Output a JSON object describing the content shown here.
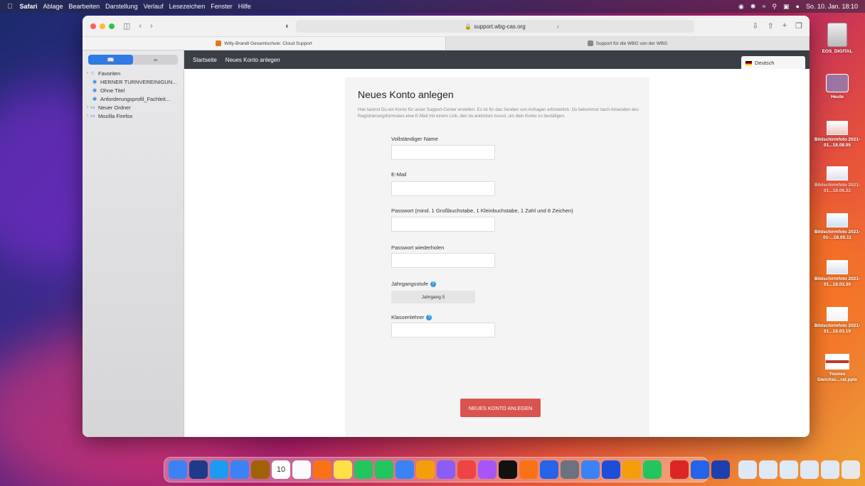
{
  "menubar": {
    "items": [
      "Safari",
      "Ablage",
      "Bearbeiten",
      "Darstellung",
      "Verlauf",
      "Lesezeichen",
      "Fenster",
      "Hilfe"
    ],
    "clock": "So. 10. Jan. 18:10"
  },
  "browser": {
    "address": "support.wbg-cas.org",
    "tabs": [
      {
        "title": "Willy-Brandt Gesamtschule: Cloud Support"
      },
      {
        "title": "Support für die WBG von der WBG"
      }
    ]
  },
  "sidebar": {
    "items": [
      {
        "label": "Favoriten",
        "icon": "star-icon"
      },
      {
        "label": "HERNER TURNVEREINIGUN...",
        "icon": "globe-icon"
      },
      {
        "label": "Ohne Titel",
        "icon": "globe-icon"
      },
      {
        "label": "Anforderungsprofil_Fachleit...",
        "icon": "globe-icon"
      },
      {
        "label": "Neuer Ordner",
        "icon": "folder-icon"
      },
      {
        "label": "Mozilla Firefox",
        "icon": "folder-icon"
      }
    ]
  },
  "site": {
    "nav": [
      "Startseite",
      "Neues Konto anlegen"
    ],
    "language": "Deutsch"
  },
  "form": {
    "title": "Neues Konto anlegen",
    "intro": "Hier kannst Du ein Konto für unser Support-Center erstellen. Es ist für das Senden von Anfragen erforderlich. Du bekommst nach Absenden des Registrierungsformulars eine E-Mail mit einem Link, den du anklicken musst, um dein Konto zu bestätigen.",
    "fields": {
      "name_label": "Vollständiger Name",
      "email_label": "E-Mail",
      "password_label": "Passwort (mind. 1 Großbuchstabe, 1 Kleinbuchstabe, 1 Zahl und 8 Zeichen)",
      "password_repeat_label": "Passwort wiederholen",
      "grade_label": "Jahrgangsstufe",
      "grade_value": "Jahrgang 5",
      "teacher_label": "Klassenlehrer"
    },
    "submit_label": "NEUES KONTO ANLEGEN"
  },
  "desktop": {
    "items": [
      {
        "label": "EOS_DIGITAL"
      },
      {
        "label": "Heute"
      },
      {
        "label": "Bildschirmfoto 2021-01...18.08.05"
      },
      {
        "label": "Bildschirmfoto 2021-01...18.06.22"
      },
      {
        "label": "Bildschirmfoto 2021-01-...18.05.11"
      },
      {
        "label": "Bildschirmfoto 2021-01...18.03.30"
      },
      {
        "label": "Bildschirmfoto 2021-01...18.03.19"
      },
      {
        "label": "Younes Gleichsc...rat.pptx"
      }
    ]
  },
  "dock": {
    "calendar_day": "10",
    "colors": [
      "#3b82f6",
      "#1e3a8a",
      "#1d9bf0",
      "#3b82f6",
      "#a16207",
      "#ffffff",
      "#f8fafc",
      "#f97316",
      "#fde047",
      "#22c55e",
      "#22c55e",
      "#3b82f6",
      "#f59e0b",
      "#8b5cf6",
      "#ef4444",
      "#a855f7",
      "#111111",
      "#f97316",
      "#2563eb",
      "#6b7280",
      "#3b82f6",
      "#1d4ed8",
      "#f59e0b",
      "#22c55e",
      "#dc2626",
      "#2563eb",
      "#1e40af"
    ]
  }
}
